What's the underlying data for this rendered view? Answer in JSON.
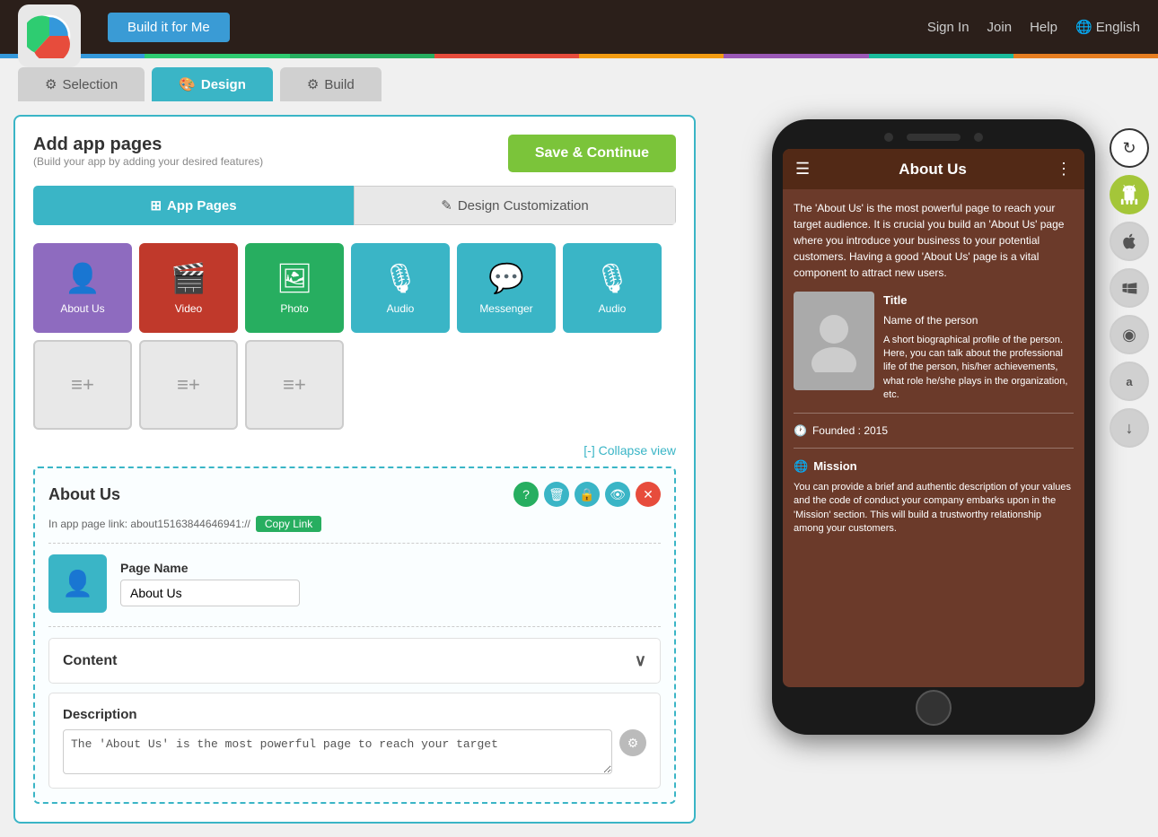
{
  "header": {
    "build_btn": "Build it for Me",
    "nav": {
      "sign_in": "Sign In",
      "join": "Join",
      "help": "Help",
      "language": "English"
    }
  },
  "color_bar": [
    "#3498db",
    "#2ecc71",
    "#e74c3c",
    "#f39c12",
    "#9b59b6",
    "#1abc9c",
    "#e67e22"
  ],
  "tabs": {
    "selection": "Selection",
    "design": "Design",
    "build": "Build"
  },
  "main": {
    "title": "Add app pages",
    "subtitle": "(Build your app by adding your desired features)",
    "save_btn": "Save & Continue",
    "sub_tabs": {
      "app_pages": "App Pages",
      "design_customization": "Design Customization"
    },
    "pages": [
      {
        "name": "About Us",
        "color": "pi-purple",
        "icon": "👤"
      },
      {
        "name": "Video",
        "color": "pi-red",
        "icon": "🎬"
      },
      {
        "name": "Photo",
        "color": "pi-green",
        "icon": "🖼"
      },
      {
        "name": "Audio",
        "color": "pi-blue",
        "icon": "🎙"
      },
      {
        "name": "Messenger",
        "color": "pi-teal",
        "icon": "💬"
      },
      {
        "name": "Audio",
        "color": "pi-blue",
        "icon": "🎙"
      }
    ],
    "empty_pages": 3,
    "collapse_link": "[-] Collapse view",
    "about_panel": {
      "title": "About Us",
      "link_label": "In app page link: about15163844646941://",
      "copy_link": "Copy Link",
      "page_name_label": "Page Name",
      "page_name_value": "About Us",
      "content_section": "Content",
      "description_label": "Description",
      "description_value": "The 'About Us' is the most powerful page to reach your target"
    }
  },
  "phone_preview": {
    "header_title": "About Us",
    "intro_text": "The 'About Us' is the most powerful page to reach your target audience. It is crucial you build an 'About Us' page where you introduce your business to your potential customers. Having a good 'About Us' page is a vital component to attract new users.",
    "person_title": "Title",
    "person_name": "Name of the person",
    "person_bio": "A short biographical profile of the person. Here, you can talk about the professional life of the person, his/her achievements, what role he/she plays in the organization, etc.",
    "founded": "Founded : 2015",
    "mission_title": "Mission",
    "mission_text": "You can provide a brief and authentic description of your values and the code of conduct your company embarks upon in the 'Mission' section. This will build a trustworthy relationship among your customers."
  },
  "side_icons": [
    {
      "name": "refresh",
      "label": "↻"
    },
    {
      "name": "android",
      "label": "🤖"
    },
    {
      "name": "apple",
      "label": ""
    },
    {
      "name": "windows",
      "label": "⊞"
    },
    {
      "name": "blackberry",
      "label": "◉"
    },
    {
      "name": "amazon",
      "label": ""
    },
    {
      "name": "download",
      "label": "↓"
    }
  ]
}
